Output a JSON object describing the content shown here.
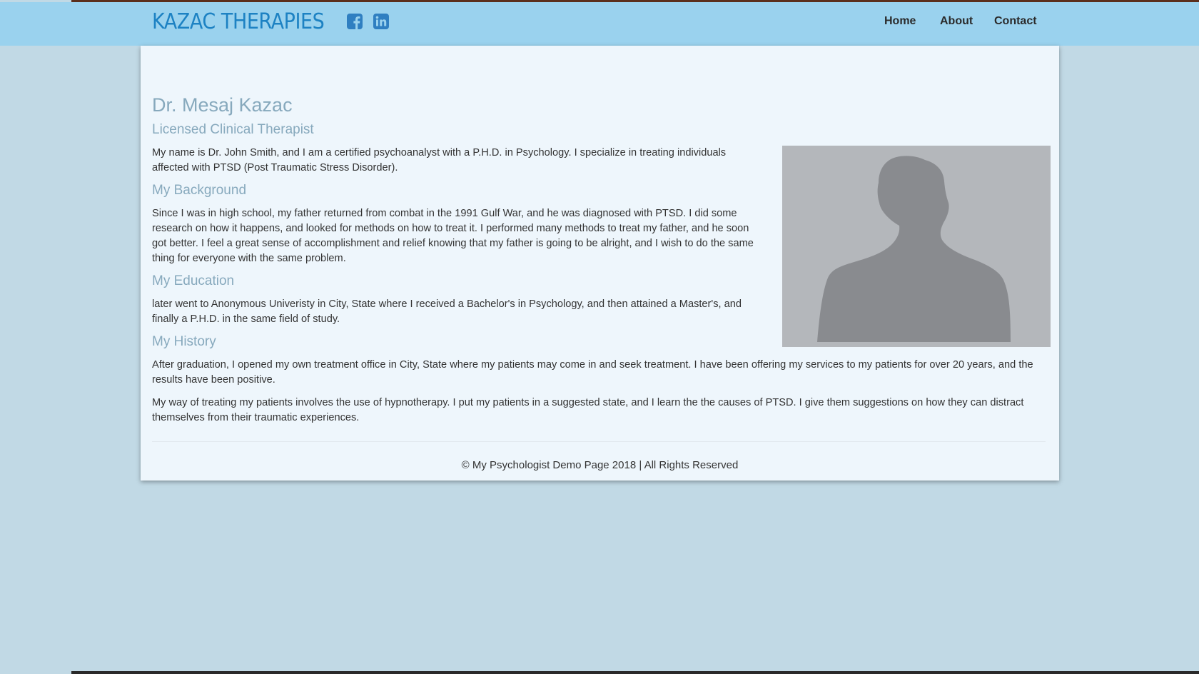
{
  "brand": {
    "name": "KAZAC THERAPIES",
    "social_icons": [
      "facebook-icon",
      "linkedin-icon"
    ]
  },
  "nav": {
    "items": [
      {
        "label": "Home"
      },
      {
        "label": "About"
      },
      {
        "label": "Contact"
      }
    ]
  },
  "profile": {
    "name": "Dr. Mesaj Kazac",
    "title": "Licensed Clinical Therapist",
    "intro": "My name is Dr. John Smith, and I am a certified psychoanalyst with a P.H.D. in Psychology. I specialize in treating individuals affected with PTSD (Post Traumatic Stress Disorder).",
    "portrait": "person-silhouette-icon"
  },
  "sections": {
    "background": {
      "heading": "My Background",
      "text": "Since I was in high school, my father returned from combat in the 1991 Gulf War, and he was diagnosed with PTSD. I did some research on how it happens, and looked for methods on how to treat it. I performed many methods to treat my father, and he soon got better. I feel a great sense of accomplishment and relief knowing that my father is going to be alright, and I wish to do the same thing for everyone with the same problem."
    },
    "education": {
      "heading": "My Education",
      "text": "later went to Anonymous Univeristy in City, State where I received a Bachelor's in Psychology, and then attained a Master's, and finally a P.H.D. in the same field of study."
    },
    "history": {
      "heading": "My History",
      "paragraphs": [
        "After graduation, I opened my own treatment office in City, State where my patients may come in and seek treatment. I have been offering my services to my patients for over 20 years, and the results have been positive.",
        "My way of treating my patients involves the use of hypnotherapy. I put my patients in a suggested state, and I learn the the causes of PTSD. I give them suggestions on how they can distract themselves from their traumatic experiences."
      ]
    }
  },
  "footer": {
    "text": "© My Psychologist Demo Page 2018 | All Rights Reserved"
  },
  "colors": {
    "page_background": "#c1d9e5",
    "navbar": "#9ad2ee",
    "brand": "#1d82c3",
    "panel": "#eef6fc",
    "heading": "#87a9bd",
    "body_text": "#333333",
    "top_rule": "#5b2f1c"
  }
}
